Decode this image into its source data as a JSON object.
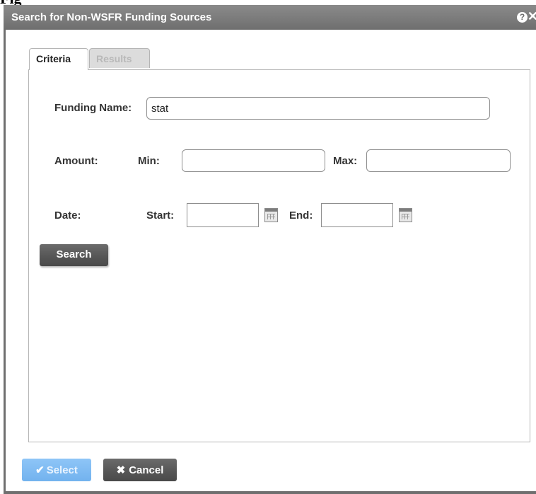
{
  "page_fragment": "Fig",
  "dialog": {
    "title": "Search for Non-WSFR Funding Sources",
    "help_icon": "?"
  },
  "tabs": [
    {
      "label": "Criteria",
      "active": true
    },
    {
      "label": "Results",
      "active": false
    }
  ],
  "form": {
    "funding_name_label": "Funding Name:",
    "funding_name_value": "stat",
    "amount_label": "Amount:",
    "min_label": "Min:",
    "min_value": "",
    "max_label": "Max:",
    "max_value": "",
    "date_label": "Date:",
    "start_label": "Start:",
    "start_value": "",
    "end_label": "End:",
    "end_value": ""
  },
  "buttons": {
    "search": "Search",
    "select": "Select",
    "cancel": "Cancel"
  },
  "colors": {
    "titlebar": "#7a7a7a",
    "select_button": "#7fbcf3",
    "dark_button": "#555555"
  }
}
